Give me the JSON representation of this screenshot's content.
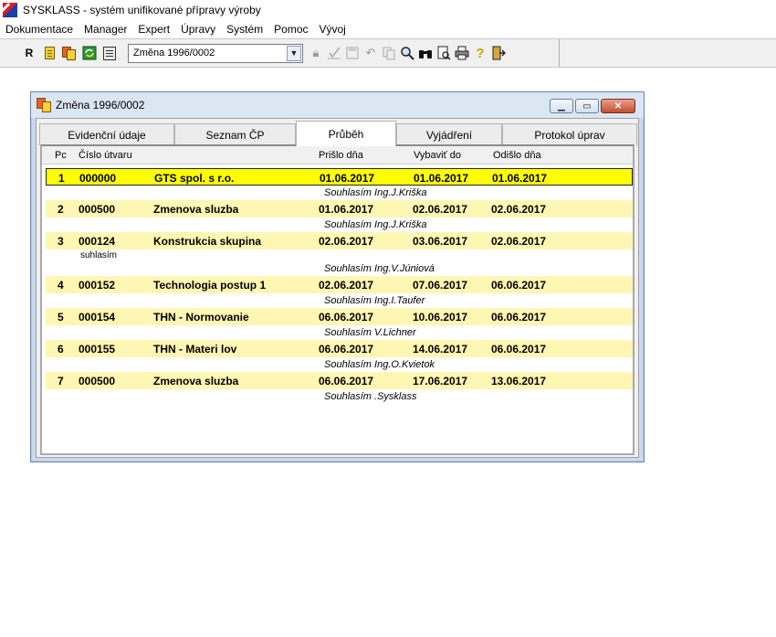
{
  "app": {
    "title": "SYSKLASS - systém unifikované přípravy výroby"
  },
  "menu": [
    {
      "label": "Dokumentace"
    },
    {
      "label": "Manager"
    },
    {
      "label": "Expert"
    },
    {
      "label": "Úpravy"
    },
    {
      "label": "Systém"
    },
    {
      "label": "Pomoc"
    },
    {
      "label": "Vývoj"
    }
  ],
  "toolbar": {
    "r_label": "R",
    "record_select": {
      "value": "Změna 1996/0002"
    }
  },
  "window": {
    "title": "Změna 1996/0002",
    "tabs": [
      {
        "label": "Evidenční údaje"
      },
      {
        "label": "Seznam ČP"
      },
      {
        "label": "Průběh"
      },
      {
        "label": "Vyjádření"
      },
      {
        "label": "Protokol úprav"
      }
    ],
    "active_tab": "Průběh",
    "grid": {
      "headers": {
        "pc": "Pc",
        "cislo": "Číslo útvaru",
        "prislo": "Prišlo dňa",
        "vybavit": "Vybaviť do",
        "odislo": "Odišlo dňa"
      },
      "rows": [
        {
          "pc": "1",
          "cislo": "000000",
          "nazev": "GTS spol. s r.o.",
          "prislo": "01.06.2017",
          "vybavit": "01.06.2017",
          "odislo": "01.06.2017",
          "note": "",
          "approval": "Souhlasím  Ing.J.Kriška"
        },
        {
          "pc": "2",
          "cislo": "000500",
          "nazev": "Zmenova sluzba",
          "prislo": "01.06.2017",
          "vybavit": "02.06.2017",
          "odislo": "02.06.2017",
          "note": "",
          "approval": "Souhlasím  Ing.J.Kriška"
        },
        {
          "pc": "3",
          "cislo": "000124",
          "nazev": "Konstrukcia skupina",
          "prislo": "02.06.2017",
          "vybavit": "03.06.2017",
          "odislo": "02.06.2017",
          "note": "suhlasím",
          "approval": "Souhlasím  Ing.V.Júniová"
        },
        {
          "pc": "4",
          "cislo": "000152",
          "nazev": "Technologia postup 1",
          "prislo": "02.06.2017",
          "vybavit": "07.06.2017",
          "odislo": "06.06.2017",
          "note": "",
          "approval": "Souhlasím  Ing.I.Taufer"
        },
        {
          "pc": "5",
          "cislo": "000154",
          "nazev": "THN - Normovanie",
          "prislo": "06.06.2017",
          "vybavit": "10.06.2017",
          "odislo": "06.06.2017",
          "note": "",
          "approval": "Souhlasím  V.Lichner"
        },
        {
          "pc": "6",
          "cislo": "000155",
          "nazev": "THN - Materi lov",
          "prislo": "06.06.2017",
          "vybavit": "14.06.2017",
          "odislo": "06.06.2017",
          "note": "",
          "approval": "Souhlasím  Ing.O.Kvietok"
        },
        {
          "pc": "7",
          "cislo": "000500",
          "nazev": "Zmenova sluzba",
          "prislo": "06.06.2017",
          "vybavit": "17.06.2017",
          "odislo": "13.06.2017",
          "note": "",
          "approval": "Souhlasím  .Sysklass"
        }
      ]
    }
  },
  "icons": {
    "logo": "sysklass-logo-icon",
    "toolbar": [
      "document-icon",
      "documents-icon",
      "sync-icon",
      "calendar-icon",
      "lock-icon",
      "approve-icon",
      "save-icon",
      "undo-icon",
      "copy-icon",
      "search-icon",
      "binoculars-icon",
      "preview-icon",
      "print-icon",
      "help-icon",
      "exit-icon"
    ]
  },
  "colors": {
    "row_highlight": "#fef7b4",
    "row_selected": "#ffff00"
  }
}
